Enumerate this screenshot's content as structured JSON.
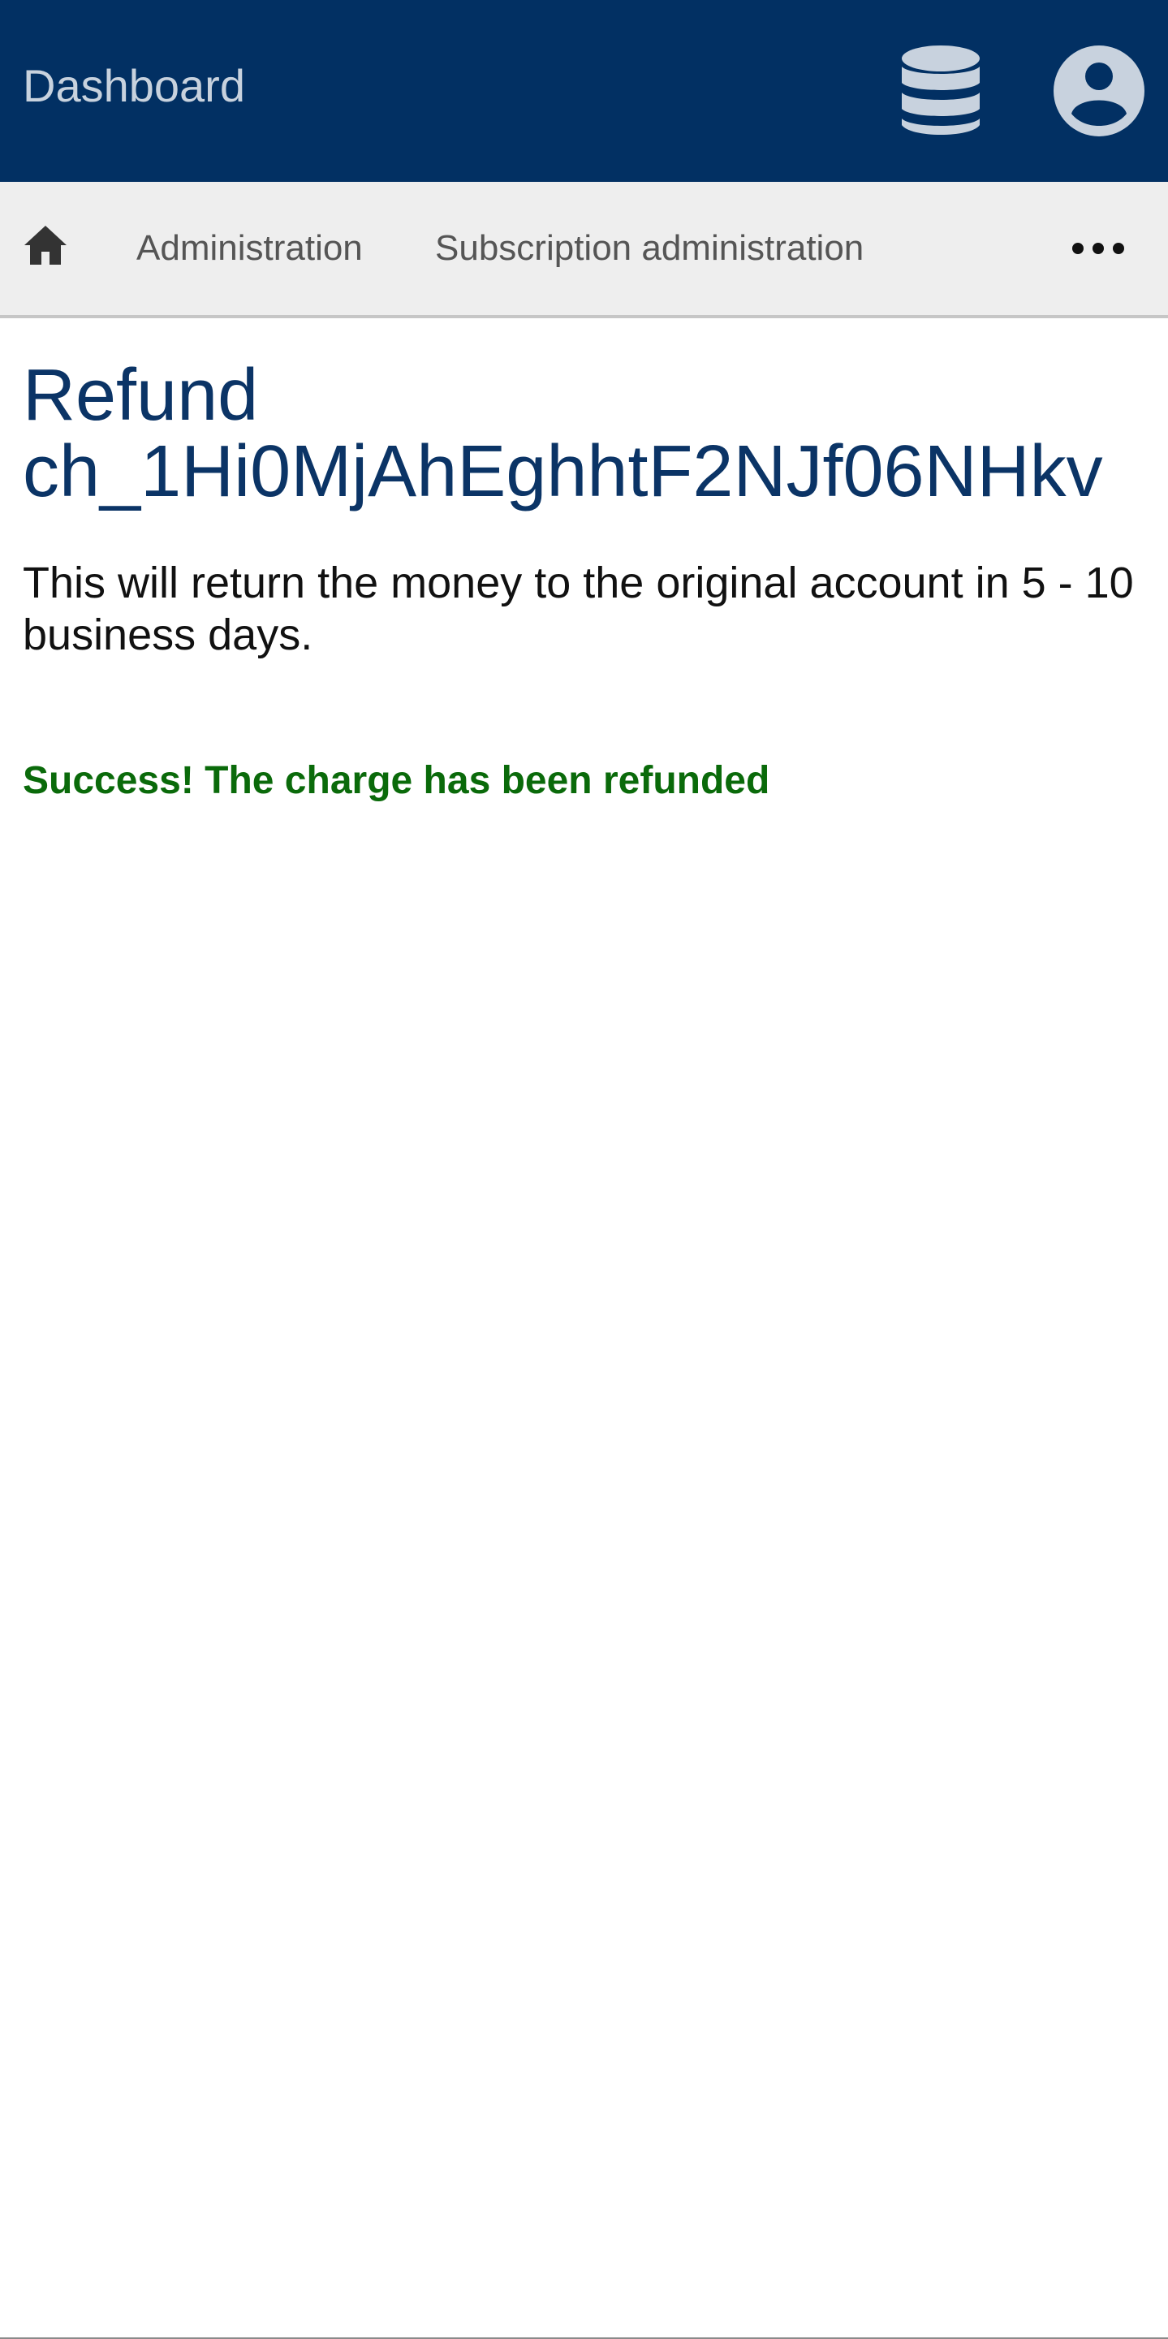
{
  "header": {
    "brand": "Dashboard",
    "icons": [
      "database-icon",
      "account-circle-icon"
    ]
  },
  "nav": {
    "home_icon": "home-icon",
    "items": [
      "Administration",
      "Subscription administration"
    ],
    "more_icon": "more-horizontal-icon"
  },
  "main": {
    "title": "Refund ch_1Hi0MjAhEghhtF2NJf06NHkv",
    "description": "This will return the money to the original account in 5 - 10 business days.",
    "success_message": "Success! The charge has been refunded"
  },
  "colors": {
    "header_bg": "#023063",
    "header_icon": "#c8d2de",
    "nav_bg": "#eeeeee",
    "title": "#0b3466",
    "success": "#0a6a0a"
  }
}
